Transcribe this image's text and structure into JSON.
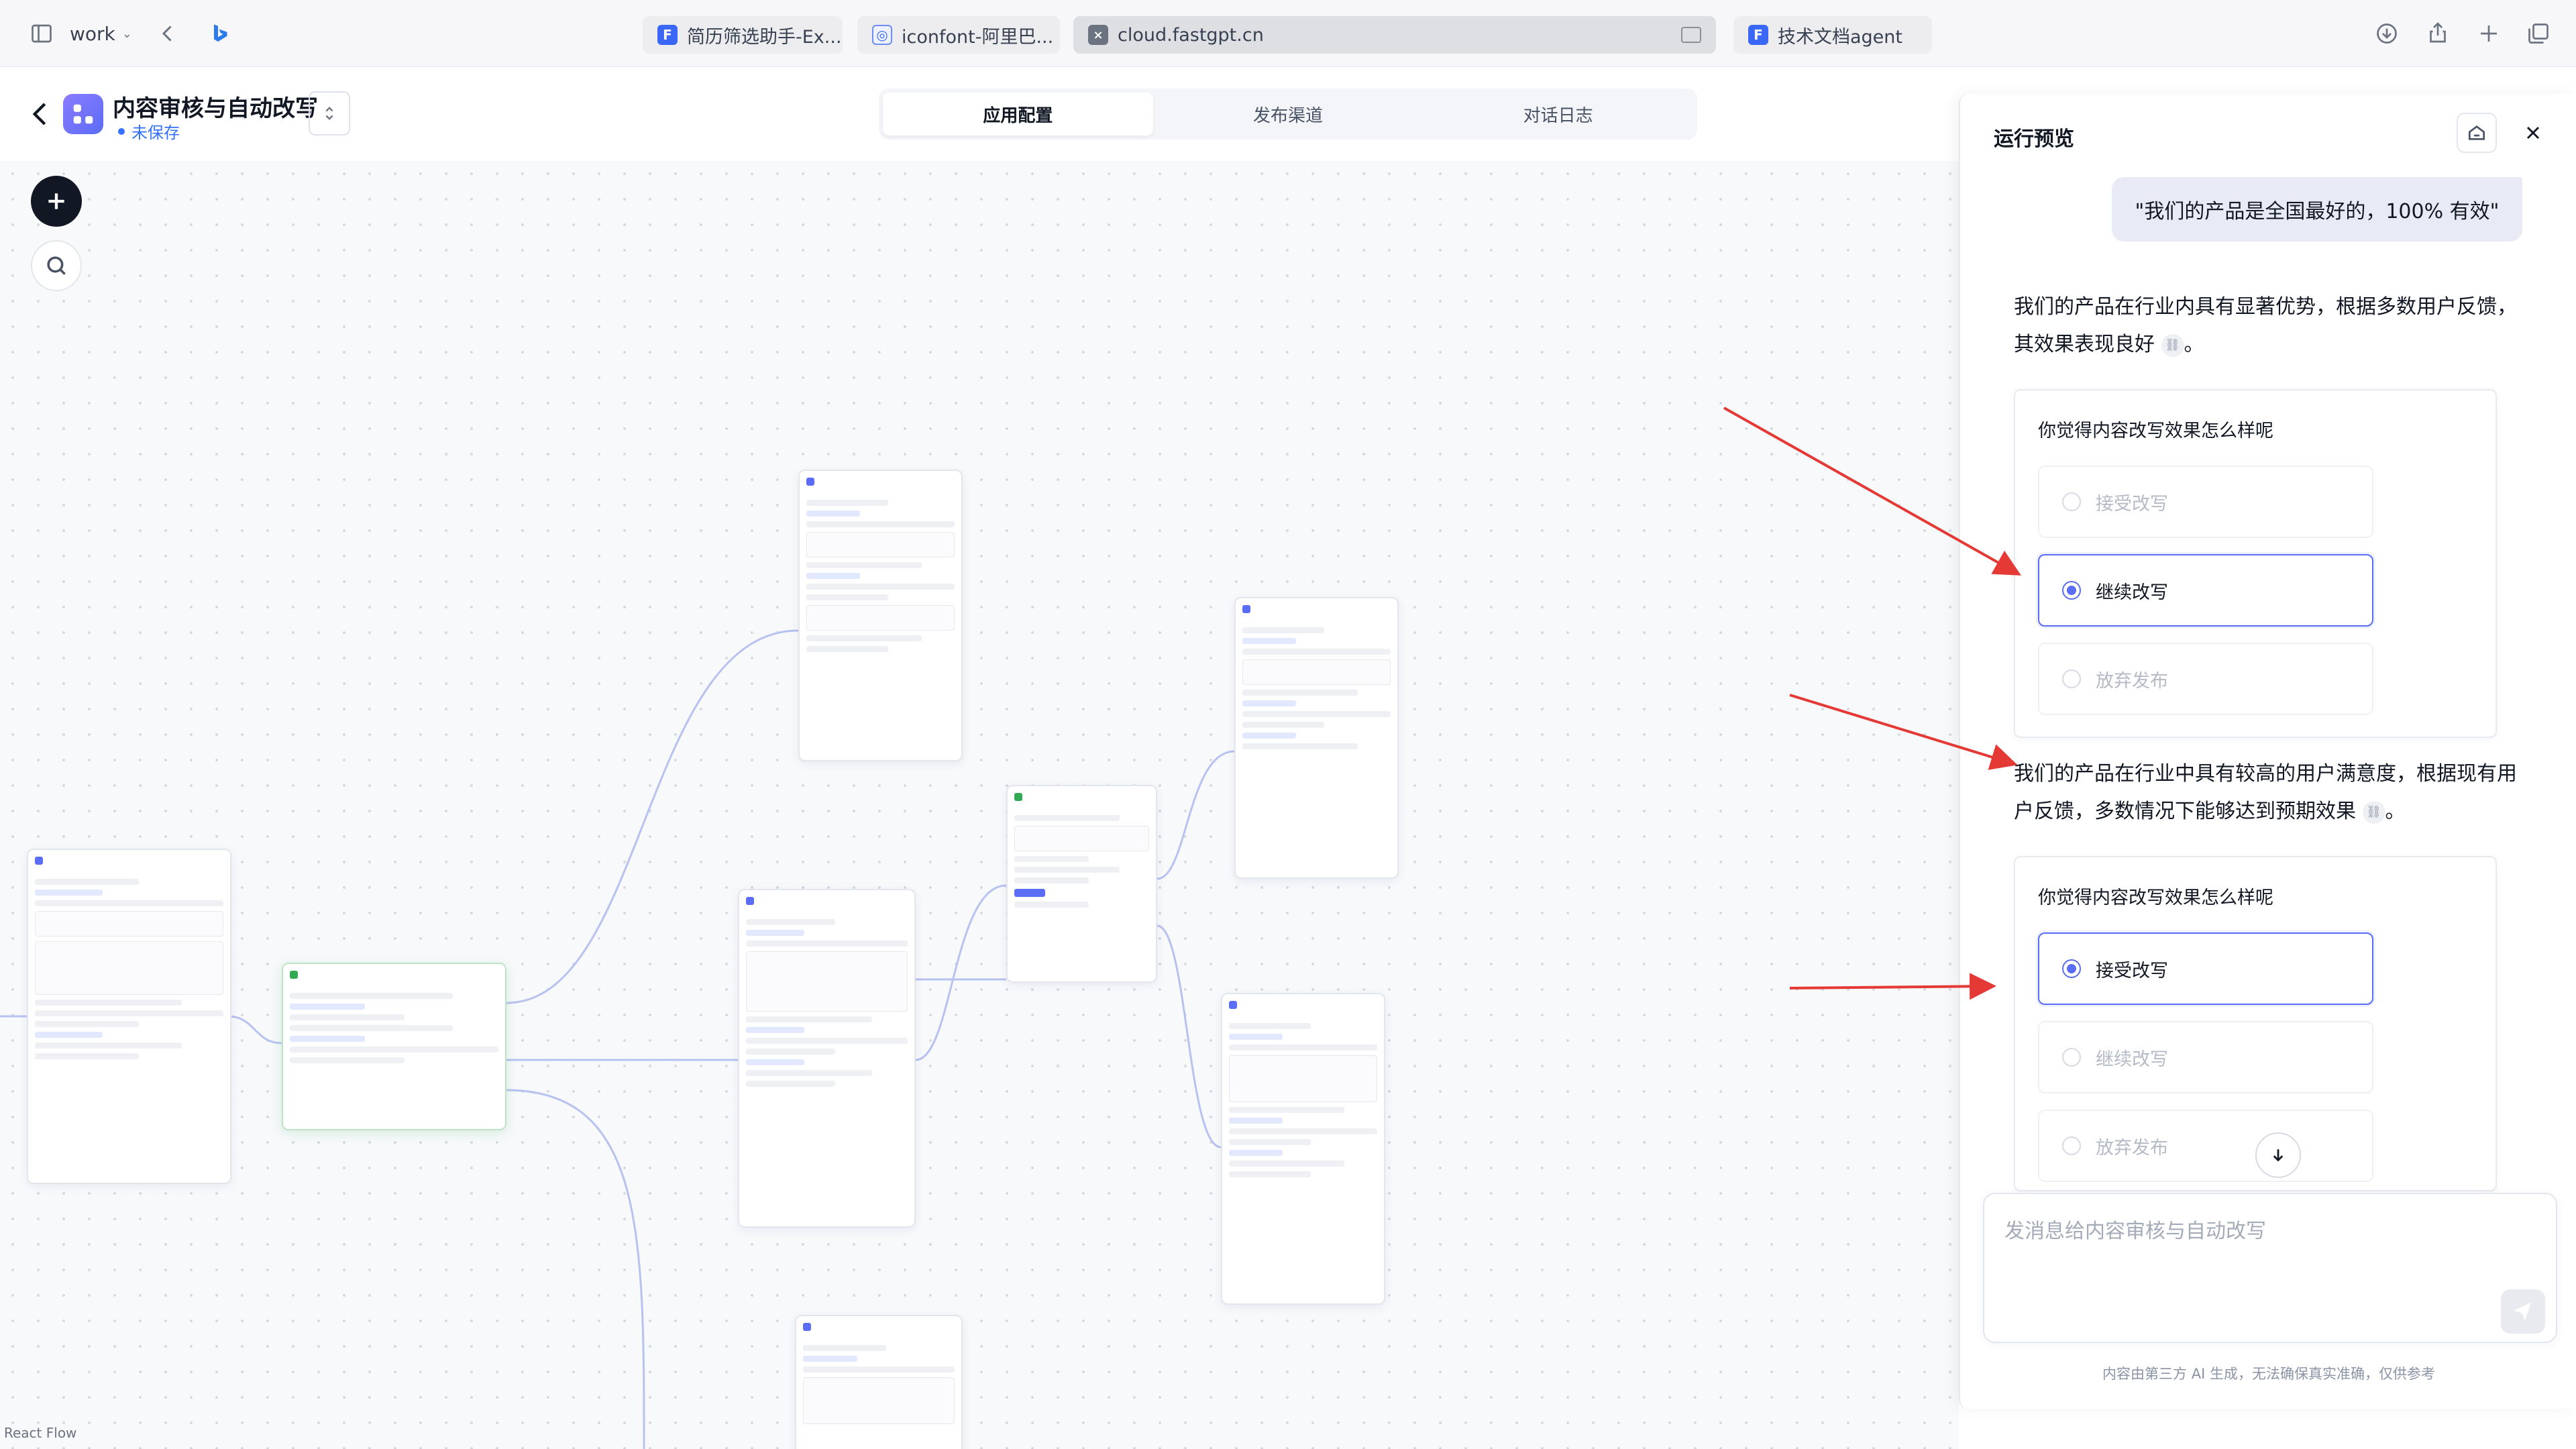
{
  "browser": {
    "workspace": "work",
    "tabs": [
      {
        "title": "简历筛选助手-Ex...",
        "favicon": "F"
      },
      {
        "title": "iconfont-阿里巴...",
        "favicon": "◎"
      },
      {
        "title": "cloud.fastgpt.cn",
        "favicon": "×"
      },
      {
        "title": "技术文档agent",
        "favicon": "F"
      }
    ]
  },
  "app": {
    "title": "内容审核与自动改写",
    "status": "未保存",
    "tabs": [
      "应用配置",
      "发布渠道",
      "对话日志"
    ],
    "active_tab": 0
  },
  "canvas": {
    "footer_label": "React Flow"
  },
  "preview": {
    "title": "运行预览",
    "user_message": "\"我们的产品是全国最好的，100% 有效\"",
    "responses": [
      {
        "text": "我们的产品在行业内具有显著优势，根据多数用户反馈，其效果表现良好"
      },
      {
        "text": "我们的产品在行业中具有较高的用户满意度，根据现有用户反馈，多数情况下能够达到预期效果"
      }
    ],
    "sentence_end": "。",
    "feedback_cards": [
      {
        "question": "你觉得内容改写效果怎么样呢",
        "options": [
          "接受改写",
          "继续改写",
          "放弃发布"
        ],
        "selected": 1
      },
      {
        "question": "你觉得内容改写效果怎么样呢",
        "options": [
          "接受改写",
          "继续改写",
          "放弃发布"
        ],
        "selected": 0
      }
    ],
    "input_placeholder": "发消息给内容审核与自动改写",
    "disclaimer": "内容由第三方 AI 生成，无法确保真实准确，仅供参考"
  },
  "colors": {
    "accent": "#5b6cf5",
    "link": "#3370ff",
    "annotation_arrow": "#e53935"
  },
  "icons": [
    "sidebar-icon",
    "chevron-left-icon",
    "bing-icon",
    "download-icon",
    "share-icon",
    "plus-icon",
    "tabs-icon",
    "swap-icon",
    "add-node-icon",
    "search-icon",
    "home-icon",
    "close-icon",
    "chevron-down-icon",
    "send-icon",
    "quote-icon"
  ]
}
